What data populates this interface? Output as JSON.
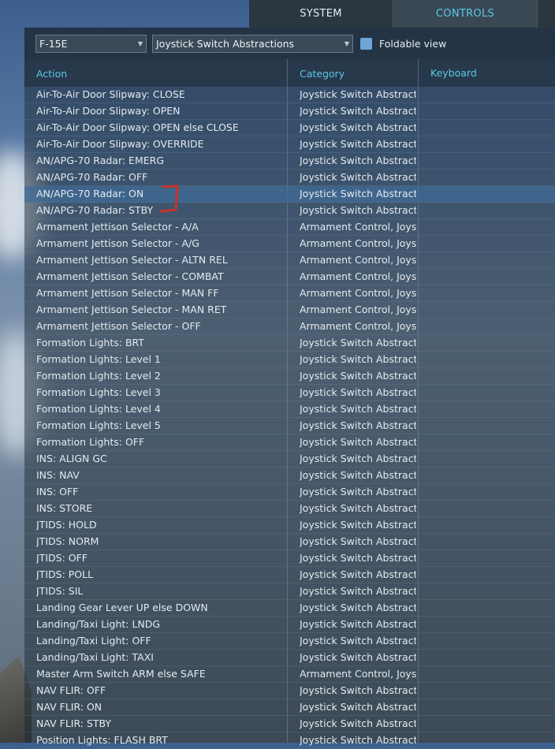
{
  "tabs": {
    "system": "SYSTEM",
    "controls": "CONTROLS"
  },
  "toolbar": {
    "aircraft": "F-15E",
    "category_filter": "Joystick Switch Abstractions",
    "foldable_label": "Foldable view"
  },
  "columns": {
    "action": "Action",
    "category": "Category",
    "keyboard": "Keyboard"
  },
  "selected_row": "AN/APG-70 Radar: ON",
  "rows": [
    {
      "action": "Air-To-Air Door Slipway: CLOSE",
      "category": "Joystick Switch Abstractio"
    },
    {
      "action": "Air-To-Air Door Slipway: OPEN",
      "category": "Joystick Switch Abstractio"
    },
    {
      "action": "Air-To-Air Door Slipway: OPEN else CLOSE",
      "category": "Joystick Switch Abstractio"
    },
    {
      "action": "Air-To-Air Door Slipway: OVERRIDE",
      "category": "Joystick Switch Abstractio"
    },
    {
      "action": "AN/APG-70 Radar: EMERG",
      "category": "Joystick Switch Abstractio"
    },
    {
      "action": "AN/APG-70 Radar: OFF",
      "category": "Joystick Switch Abstractio"
    },
    {
      "action": "AN/APG-70 Radar: ON",
      "category": "Joystick Switch Abstractio"
    },
    {
      "action": "AN/APG-70 Radar: STBY",
      "category": "Joystick Switch Abstractio"
    },
    {
      "action": "Armament Jettison Selector - A/A",
      "category": "Armament Control, Joystic"
    },
    {
      "action": "Armament Jettison Selector - A/G",
      "category": "Armament Control, Joystic"
    },
    {
      "action": "Armament Jettison Selector - ALTN REL",
      "category": "Armament Control, Joystic"
    },
    {
      "action": "Armament Jettison Selector - COMBAT",
      "category": "Armament Control, Joystic"
    },
    {
      "action": "Armament Jettison Selector - MAN FF",
      "category": "Armament Control, Joystic"
    },
    {
      "action": "Armament Jettison Selector - MAN RET",
      "category": "Armament Control, Joystic"
    },
    {
      "action": "Armament Jettison Selector - OFF",
      "category": "Armament Control, Joystic"
    },
    {
      "action": "Formation Lights: BRT",
      "category": "Joystick Switch Abstractio"
    },
    {
      "action": "Formation Lights: Level 1",
      "category": "Joystick Switch Abstractio"
    },
    {
      "action": "Formation Lights: Level 2",
      "category": "Joystick Switch Abstractio"
    },
    {
      "action": "Formation Lights: Level 3",
      "category": "Joystick Switch Abstractio"
    },
    {
      "action": "Formation Lights: Level 4",
      "category": "Joystick Switch Abstractio"
    },
    {
      "action": "Formation Lights: Level 5",
      "category": "Joystick Switch Abstractio"
    },
    {
      "action": "Formation Lights: OFF",
      "category": "Joystick Switch Abstractio"
    },
    {
      "action": "INS: ALIGN GC",
      "category": "Joystick Switch Abstractio"
    },
    {
      "action": "INS: NAV",
      "category": "Joystick Switch Abstractio"
    },
    {
      "action": "INS: OFF",
      "category": "Joystick Switch Abstractio"
    },
    {
      "action": "INS: STORE",
      "category": "Joystick Switch Abstractio"
    },
    {
      "action": "JTIDS: HOLD",
      "category": "Joystick Switch Abstractio"
    },
    {
      "action": "JTIDS: NORM",
      "category": "Joystick Switch Abstractio"
    },
    {
      "action": "JTIDS: OFF",
      "category": "Joystick Switch Abstractio"
    },
    {
      "action": "JTIDS: POLL",
      "category": "Joystick Switch Abstractio"
    },
    {
      "action": "JTIDS: SIL",
      "category": "Joystick Switch Abstractio"
    },
    {
      "action": "Landing Gear Lever UP else DOWN",
      "category": "Joystick Switch Abstractio"
    },
    {
      "action": "Landing/Taxi Light: LNDG",
      "category": "Joystick Switch Abstractio"
    },
    {
      "action": "Landing/Taxi Light: OFF",
      "category": "Joystick Switch Abstractio"
    },
    {
      "action": "Landing/Taxi Light: TAXI",
      "category": "Joystick Switch Abstractio"
    },
    {
      "action": "Master Arm Switch ARM else SAFE",
      "category": "Armament Control, Joystic"
    },
    {
      "action": "NAV FLIR: OFF",
      "category": "Joystick Switch Abstractio"
    },
    {
      "action": "NAV FLIR: ON",
      "category": "Joystick Switch Abstractio"
    },
    {
      "action": "NAV FLIR: STBY",
      "category": "Joystick Switch Abstractio"
    },
    {
      "action": "Position Lights: FLASH BRT",
      "category": "Joystick Switch Abstractio"
    }
  ]
}
